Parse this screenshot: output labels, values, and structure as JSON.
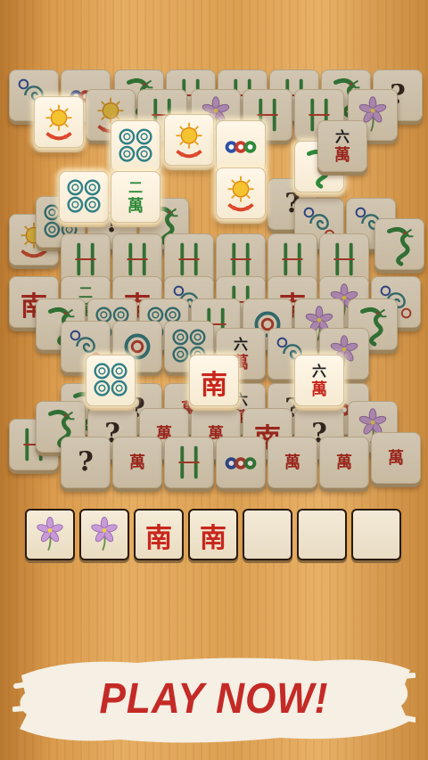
{
  "game": {
    "tray": {
      "slots": [
        {
          "kind": "orchid"
        },
        {
          "kind": "orchid"
        },
        {
          "kind": "south",
          "glyph": "南"
        },
        {
          "kind": "south",
          "glyph": "南"
        },
        {
          "kind": "empty"
        },
        {
          "kind": "empty"
        },
        {
          "kind": "empty"
        }
      ]
    },
    "cta_label": "PLAY NOW!",
    "glyphs": {
      "south": "南",
      "two_wan": "二",
      "six_wan": "六",
      "wan": "萬",
      "question": "?"
    },
    "colors": {
      "south_red": "#c8261c",
      "cta_red": "#c42a26",
      "dragon_green": "#2f8a3a",
      "circle_teal": "#2f7f86",
      "circle_blue": "#2e4fa8"
    }
  }
}
